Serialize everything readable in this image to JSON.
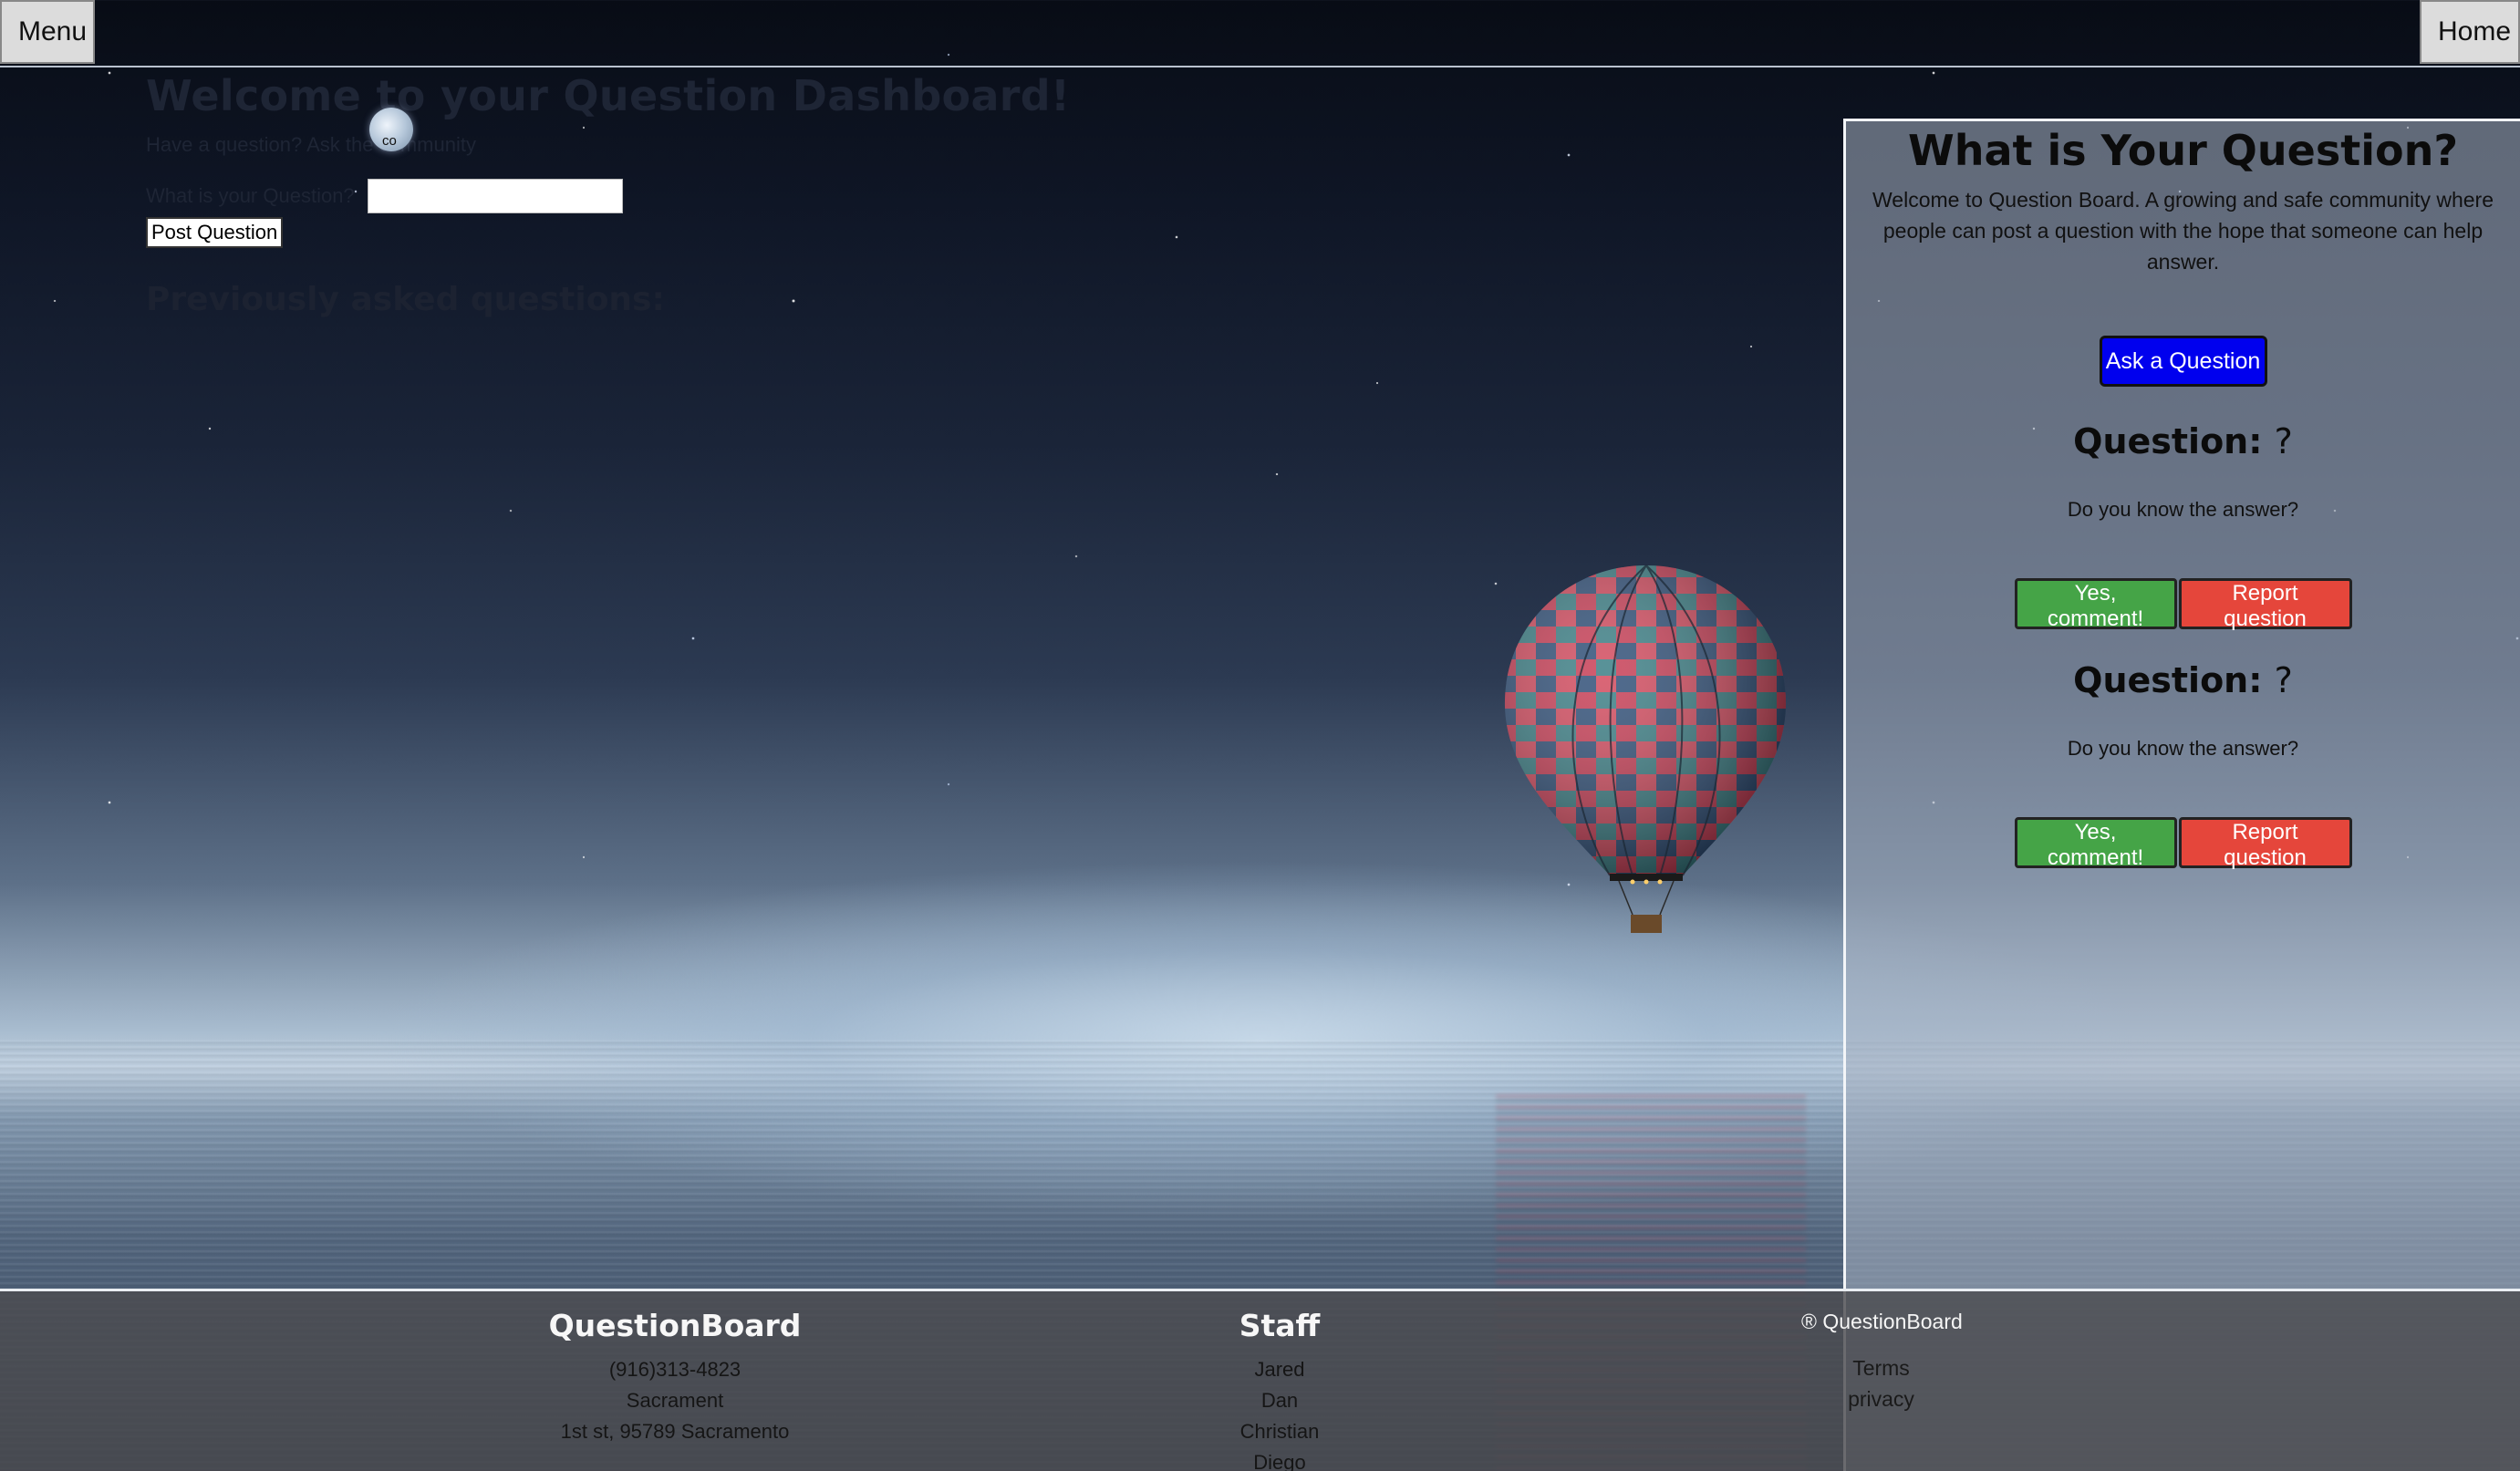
{
  "topbar": {
    "menu_label": "Menu",
    "home_label": "Home"
  },
  "dashboard": {
    "title": "Welcome to your Question Dashboard!",
    "subtitle": "Have a question? Ask the community",
    "question_label": "What is your Question?",
    "question_value": "",
    "post_button": "Post Question",
    "previous_heading": "Previously asked questions:",
    "logo_text": "co"
  },
  "panel": {
    "title": "What is Your Question?",
    "intro": "Welcome to Question Board. A growing and safe community where people can post a question with the hope that someone can help answer.",
    "ask_button": "Ask a Question",
    "questions": [
      {
        "title": "Question:",
        "mark": "?",
        "prompt": "Do you know the answer?",
        "yes_label": "Yes, comment!",
        "report_label": "Report question"
      },
      {
        "title": "Question:",
        "mark": "?",
        "prompt": "Do you know the answer?",
        "yes_label": "Yes, comment!",
        "report_label": "Report question"
      }
    ],
    "colors": {
      "ask": "#0000ee",
      "yes": "#45a447",
      "report": "#e5463b"
    }
  },
  "footer": {
    "brand": {
      "title": "QuestionBoard",
      "phone": "(916)313-4823",
      "city": "Sacrament",
      "address": "1st st, 95789 Sacramento"
    },
    "staff": {
      "title": "Staff",
      "members": [
        "Jared",
        "Dan",
        "Christian",
        "Diego"
      ]
    },
    "legal": {
      "copyright": "® QuestionBoard",
      "terms": "Terms",
      "privacy": "privacy"
    }
  }
}
